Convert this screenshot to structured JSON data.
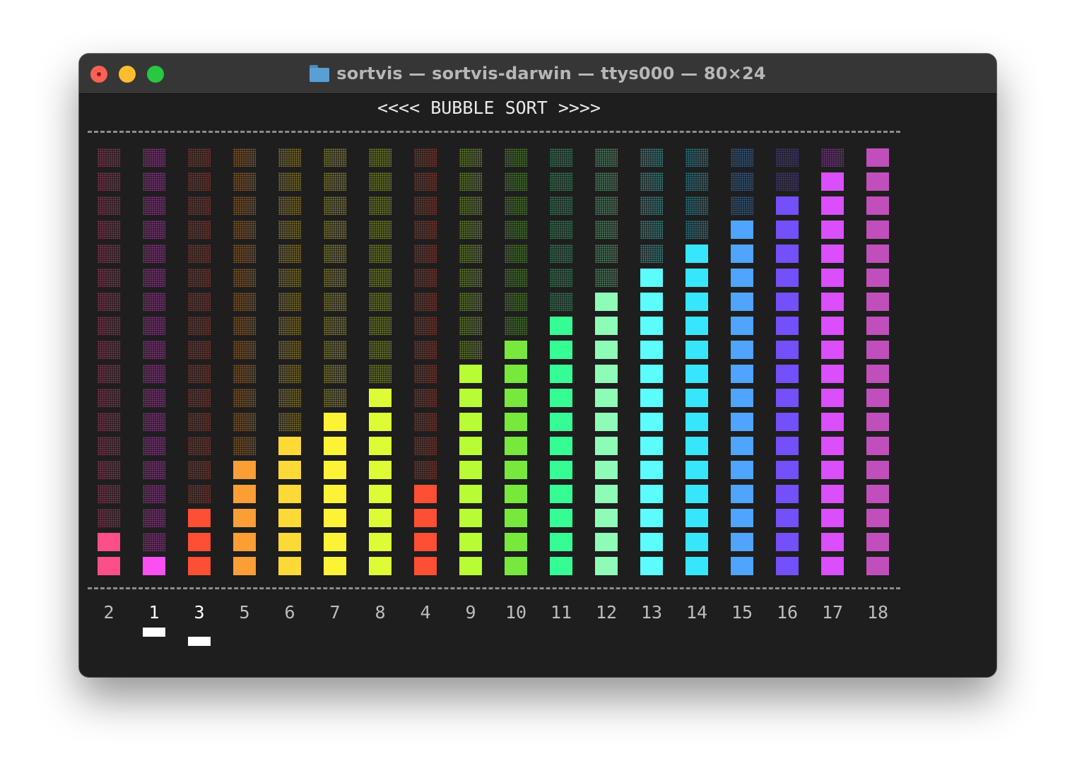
{
  "window": {
    "title": "sortvis — sortvis-darwin — ttys000 — 80×24",
    "folder_icon": "folder-icon"
  },
  "heading": "<<<< BUBBLE SORT >>>>",
  "divider_char": "-",
  "chart_data": {
    "type": "bar",
    "title": "<<<< BUBBLE SORT >>>>",
    "max_height": 18,
    "values": [
      2,
      1,
      3,
      5,
      6,
      7,
      8,
      4,
      9,
      10,
      11,
      12,
      13,
      14,
      15,
      16,
      17,
      18
    ],
    "categories": [
      "2",
      "1",
      "3",
      "5",
      "6",
      "7",
      "8",
      "4",
      "9",
      "10",
      "11",
      "12",
      "13",
      "14",
      "15",
      "16",
      "17",
      "18"
    ],
    "colors": [
      "#fc4f8a",
      "#fc4ff2",
      "#fc4f36",
      "#fc9e36",
      "#fcd936",
      "#fcf236",
      "#ddfc36",
      "#fc4f36",
      "#b8fc36",
      "#78e83c",
      "#36fc94",
      "#8efcb6",
      "#5cfcfc",
      "#38e6fc",
      "#4fa4fc",
      "#744ffc",
      "#d94ffc",
      "#c04fbc"
    ],
    "active_indices": [
      1,
      2
    ],
    "cursor_levels": [
      0,
      1
    ]
  }
}
